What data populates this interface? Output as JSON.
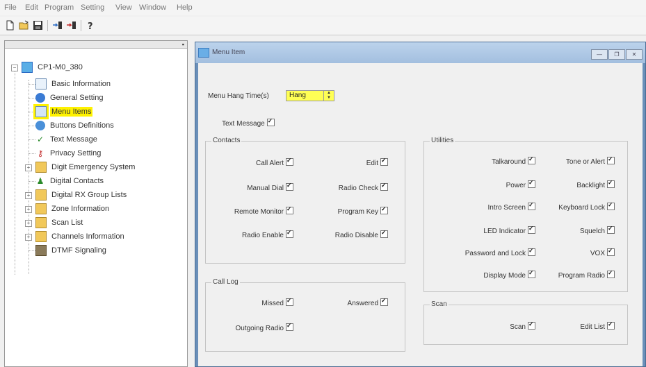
{
  "menubar": {
    "file": "File",
    "edit": "Edit",
    "program": "Program",
    "setting": "Setting",
    "view": "View",
    "window": "Window",
    "help": "Help"
  },
  "tree": {
    "root": "CP1-M0_380",
    "items": [
      "Basic Information",
      "General Setting",
      "Menu Items",
      "Buttons Definitions",
      "Text Message",
      "Privacy Setting",
      "Digit Emergency System",
      "Digital Contacts",
      "Digital RX Group Lists",
      "Zone Information",
      "Scan List",
      "Channels Information",
      "DTMF Signaling"
    ]
  },
  "window": {
    "title": "Menu Item",
    "hang_time_label": "Menu Hang Time(s)",
    "hang_time_value": "Hang",
    "text_message": "Text Message",
    "contacts": {
      "title": "Contacts",
      "call_alert": "Call Alert",
      "edit": "Edit",
      "manual_dial": "Manual Dial",
      "radio_check": "Radio Check",
      "remote_monitor": "Remote Monitor",
      "program_key": "Program Key",
      "radio_enable": "Radio Enable",
      "radio_disable": "Radio Disable"
    },
    "call_log": {
      "title": "Call Log",
      "missed": "Missed",
      "answered": "Answered",
      "outgoing_radio": "Outgoing Radio"
    },
    "utilities": {
      "title": "Utilities",
      "talkaround": "Talkaround",
      "tone_or_alert": "Tone or Alert",
      "power": "Power",
      "backlight": "Backlight",
      "intro_screen": "Intro Screen",
      "keyboard_lock": "Keyboard Lock",
      "led_indicator": "LED Indicator",
      "squelch": "Squelch",
      "password_and_lock": "Password and Lock",
      "vox": "VOX",
      "display_mode": "Display Mode",
      "program_radio": "Program Radio"
    },
    "scan": {
      "title": "Scan",
      "scan": "Scan",
      "edit_list": "Edit List"
    }
  }
}
